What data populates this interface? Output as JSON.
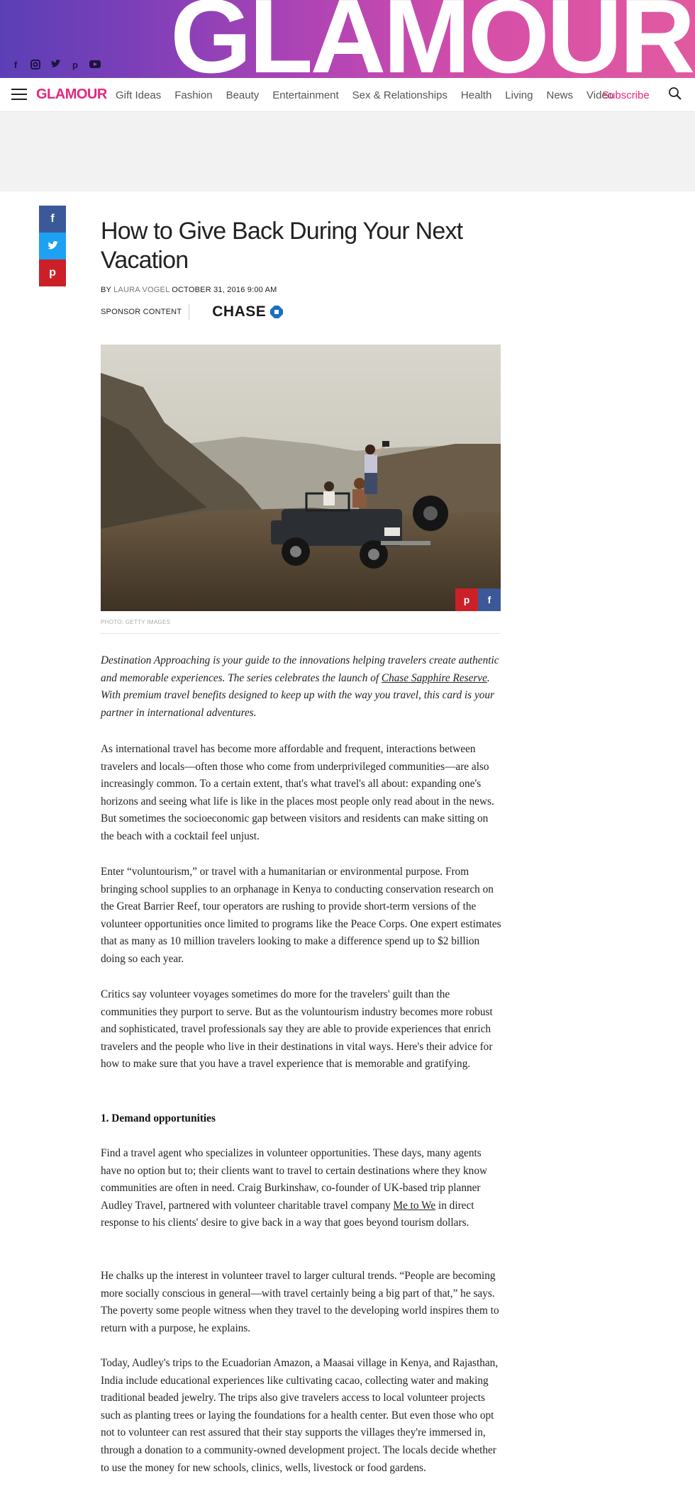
{
  "banner": {
    "word": "GLAMOUR",
    "social_icons": [
      "facebook-icon",
      "instagram-icon",
      "twitter-icon",
      "pinterest-icon",
      "youtube-icon"
    ]
  },
  "nav": {
    "logo": "GLAMOUR",
    "links": [
      "Gift Ideas",
      "Fashion",
      "Beauty",
      "Entertainment",
      "Sex & Relationships",
      "Health",
      "Living",
      "News",
      "Video"
    ],
    "subscribe": "Subscribe"
  },
  "article": {
    "title": "How to Give Back During Your Next Vacation",
    "by": "BY",
    "author": "LAURA VOGEL",
    "date": "OCTOBER 31, 2016 9:00 AM",
    "sponsor_label": "SPONSOR CONTENT",
    "sponsor_name": "CHASE",
    "photo_credit": "PHOTO: GETTY IMAGES",
    "intro_a": "Destination Approaching is your guide to the innovations helping travelers create authentic and memorable experiences. The series celebrates the launch of ",
    "intro_link": "Chase Sapphire Reserve",
    "intro_b": ". With premium travel benefits designed to keep up with the way you travel, this card is your partner in international adventures.",
    "p1": "As international travel has become more affordable and frequent, interactions between travelers and locals—often those who come from underprivileged communities—are also increasingly common. To a certain extent, that's what travel's all about: expanding one's horizons and seeing what life is like in the places most people only read about in the news. But sometimes the socioeconomic gap between visitors and residents can make sitting on the beach with a cocktail feel unjust.",
    "p2": "Enter “voluntourism,” or travel with a humanitarian or environmental purpose. From bringing school supplies to an orphanage in Kenya to conducting conservation research on the Great Barrier Reef, tour operators are rushing to provide short-term versions of the volunteer opportunities once limited to programs like the Peace Corps. One expert estimates that as many as 10 million travelers looking to make a difference spend up to $2 billion doing so each year.",
    "p3": "Critics say volunteer voyages sometimes do more for the travelers' guilt than the communities they purport to serve. But as the voluntourism industry becomes more robust and sophisticated, travel professionals say they are able to provide experiences that enrich travelers and the people who live in their destinations in vital ways. Here's their advice for how to make sure that you have a travel experience that is memorable and gratifying.",
    "heading1": "1. Demand opportunities",
    "p4_a": "Find a travel agent who specializes in volunteer opportunities. These days, many agents have no option but to; their clients want to travel to certain destinations where they know communities are often in need. Craig Burkinshaw, co-founder of UK-based trip planner Audley Travel, partnered with volunteer charitable travel company ",
    "p4_link": "Me to We",
    "p4_b": " in direct response to his clients' desire to give back in a way that goes beyond tourism dollars.",
    "p5": "He chalks up the interest in volunteer travel to larger cultural trends. “People are becoming more socially conscious in general—with travel certainly being a big part of that,” he says. The poverty some people witness when they travel to the developing world inspires them to return with a purpose, he explains.",
    "p6": "Today, Audley's trips to the Ecuadorian Amazon, a Maasai village in Kenya, and Rajasthan, India include educational experiences like cultivating cacao, collecting water and making traditional beaded jewelry. The trips also give travelers access to local volunteer projects such as planting trees or laying the foundations for a health center. But even those who opt not to volunteer can rest assured that their stay supports the villages they're immersed in, through a donation to a community-owned development project. The locals decide whether to use the money for new schools, clinics, wells, livestock or food gardens."
  },
  "colors": {
    "brand_pink": "#e4287e",
    "facebook": "#3b5998",
    "twitter": "#1da1f2",
    "pinterest": "#cb2027"
  }
}
